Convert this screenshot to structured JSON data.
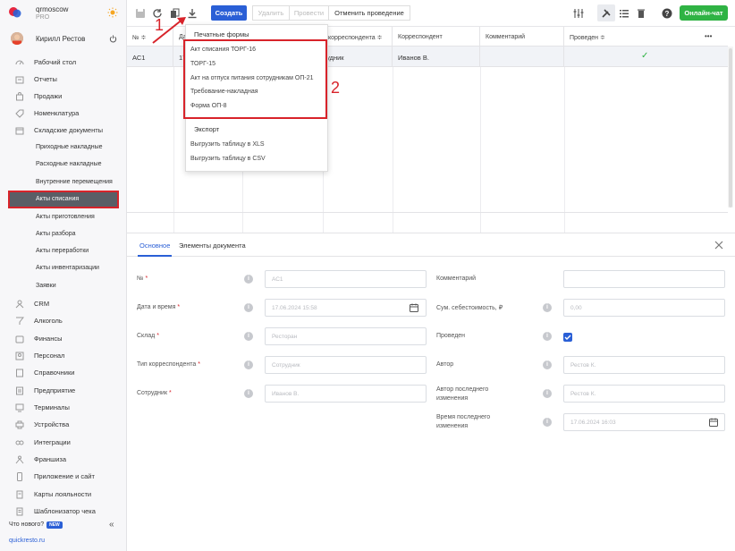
{
  "sidebar": {
    "org": "qrmoscow",
    "plan": "PRO",
    "user": "Кирилл Рестов",
    "items": [
      {
        "label": "Рабочий стол",
        "icon": "speedometer-icon"
      },
      {
        "label": "Отчеты",
        "icon": "report-icon"
      },
      {
        "label": "Продажи",
        "icon": "bag-icon"
      },
      {
        "label": "Номенклатура",
        "icon": "tag-icon"
      },
      {
        "label": "Складские документы",
        "icon": "box-icon"
      }
    ],
    "subitems": [
      "Приходные накладные",
      "Расходные накладные",
      "Внутренние перемещения",
      "Акты списания",
      "Акты приготовления",
      "Акты разбора",
      "Акты переработки",
      "Акты инвентаризации",
      "Заявки"
    ],
    "items2": [
      {
        "label": "CRM",
        "icon": "crm-icon"
      },
      {
        "label": "Алкоголь",
        "icon": "glass-icon"
      },
      {
        "label": "Финансы",
        "icon": "wallet-icon"
      },
      {
        "label": "Персонал",
        "icon": "people-icon"
      },
      {
        "label": "Справочники",
        "icon": "book-icon"
      },
      {
        "label": "Предприятие",
        "icon": "building-icon"
      },
      {
        "label": "Терминалы",
        "icon": "terminal-icon"
      },
      {
        "label": "Устройства",
        "icon": "printer-icon"
      },
      {
        "label": "Интеграции",
        "icon": "link-icon"
      },
      {
        "label": "Франшиза",
        "icon": "franchise-icon"
      },
      {
        "label": "Приложение и сайт",
        "icon": "phone-icon"
      },
      {
        "label": "Карты лояльности",
        "icon": "card-icon"
      },
      {
        "label": "Шаблонизатор чека",
        "icon": "receipt-icon"
      }
    ],
    "news": "Что нового?",
    "news_badge": "NEW",
    "collapse": "«",
    "footer": "quickresto.ru"
  },
  "toolbar": {
    "create": "Создать",
    "delete": "Удалить",
    "post": "Провести",
    "unpost": "Отменить проведение",
    "chat": "Онлайн-чат"
  },
  "grid": {
    "headers": [
      "№ ≑",
      "Да",
      "корреспондента ≑",
      "Корреспондент",
      "Комментарий",
      "Проведен ≑"
    ],
    "more": "•••",
    "row": {
      "num": "АС1",
      "date": "17",
      "type": "рудник",
      "correspondent": "Иванов В.",
      "comment": "",
      "posted": "✓"
    }
  },
  "dropdown": {
    "print_header": "Печатные формы",
    "print_items": [
      "Акт списания ТОРГ-16",
      "ТОРГ-15",
      "Акт на отпуск питания сотрудникам ОП-21",
      "Требование-накладная",
      "Форма ОП-8"
    ],
    "export_header": "Экспорт",
    "export_items": [
      "Выгрузить таблицу в XLS",
      "Выгрузить таблицу в CSV"
    ]
  },
  "annotations": {
    "one": "1",
    "two": "2"
  },
  "panel": {
    "tab_main": "Основное",
    "tab_items": "Элементы документа",
    "left_fields": [
      {
        "label": "№",
        "required": true,
        "value": "АС1"
      },
      {
        "label": "Дата и время",
        "required": true,
        "value": "17.06.2024 15:58"
      },
      {
        "label": "Склад",
        "required": true,
        "value": "Ресторан"
      },
      {
        "label": "Тип корреспондента",
        "required": true,
        "value": "Сотрудник"
      },
      {
        "label": "Сотрудник",
        "required": true,
        "value": "Иванов В."
      }
    ],
    "right_fields": [
      {
        "label": "Комментарий",
        "value": ""
      },
      {
        "label": "Сум. себестоимость, ₽",
        "value": "0,00"
      },
      {
        "label": "Проведен",
        "value": ""
      },
      {
        "label": "Автор",
        "value": "Рестов К."
      },
      {
        "label": "Автор последнего изменения",
        "value": "Рестов К."
      },
      {
        "label": "Время последнего изменения",
        "value": "17.06.2024 16:03"
      }
    ]
  },
  "colors": {
    "accent": "#2a5fd6",
    "success": "#2fb344",
    "highlight": "#d8232a"
  }
}
